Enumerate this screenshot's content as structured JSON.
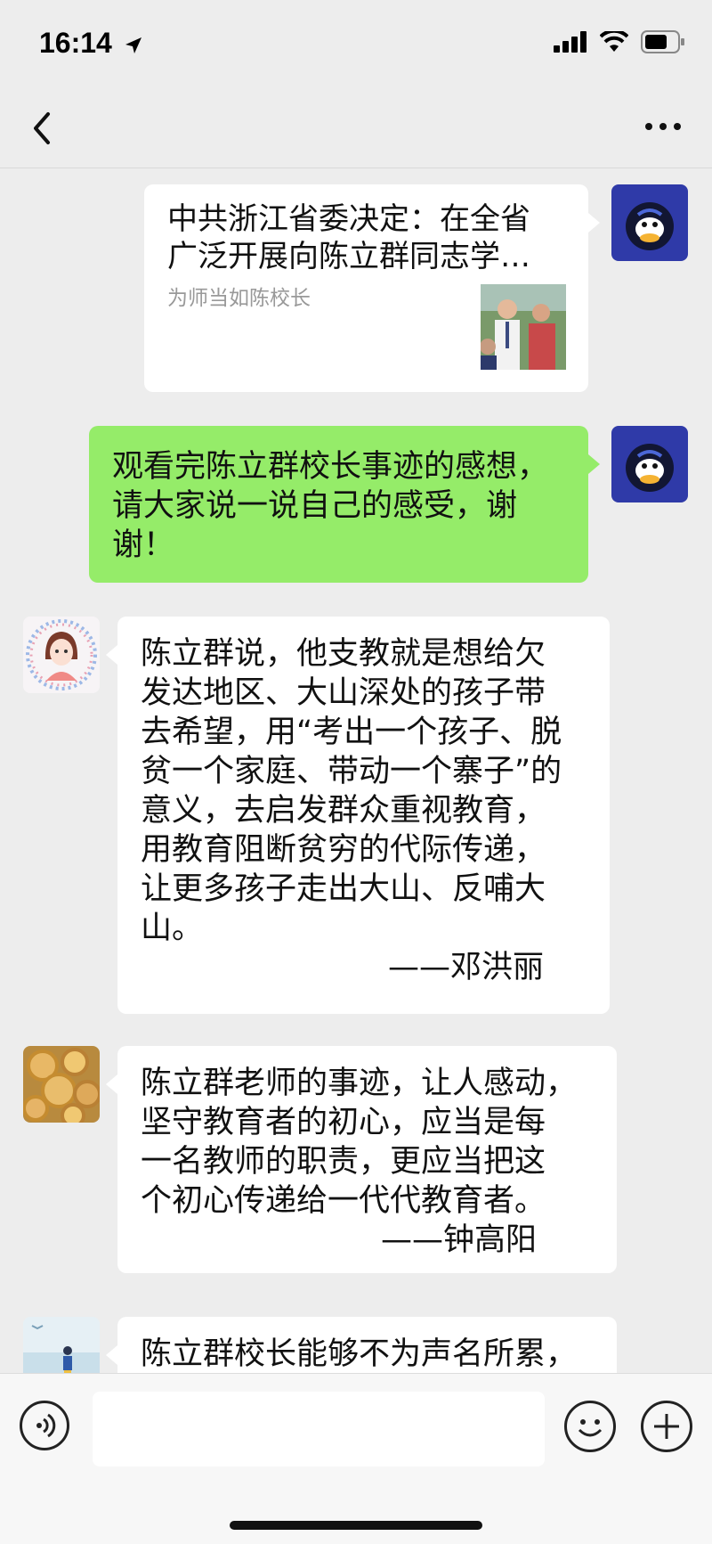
{
  "status": {
    "time": "16:14"
  },
  "messages": {
    "link": {
      "title": "中共浙江省委决定：在全省\n广泛开展向陈立群同志学…",
      "source": "为师当如陈校长"
    },
    "m2": {
      "text": "观看完陈立群校长事迹的感想，\n请大家说一说自己的感受，谢\n谢！"
    },
    "m3": {
      "text": "陈立群说，他支教就是想给欠\n发达地区、大山深处的孩子带\n去希望，用“考出一个孩子、脱\n贫一个家庭、带动一个寨子”的\n意义，去启发群众重视教育，\n用教育阻断贫穷的代际传递，\n让更多孩子走出大山、反哺大\n山。",
      "signature": "——邓洪丽"
    },
    "m4": {
      "text": "陈立群老师的事迹，让人感动，\n坚守教育者的初心，应当是每\n一名教师的职责，更应当把这\n个初心传递给一代代教育者。",
      "signature": "——钟高阳"
    },
    "m5": {
      "text": "陈立群校长能够不为声名所累，"
    }
  },
  "icons": {
    "back": "chevron-left-icon",
    "more": "more-dots-icon",
    "location": "location-arrow-icon",
    "signal": "signal-icon",
    "wifi": "wifi-icon",
    "battery": "battery-icon",
    "voice": "voice-input-icon",
    "emoji": "emoji-icon",
    "plus": "plus-icon"
  },
  "colors": {
    "background": "#ededed",
    "sent_bubble": "#95ec69",
    "received_bubble": "#ffffff"
  }
}
